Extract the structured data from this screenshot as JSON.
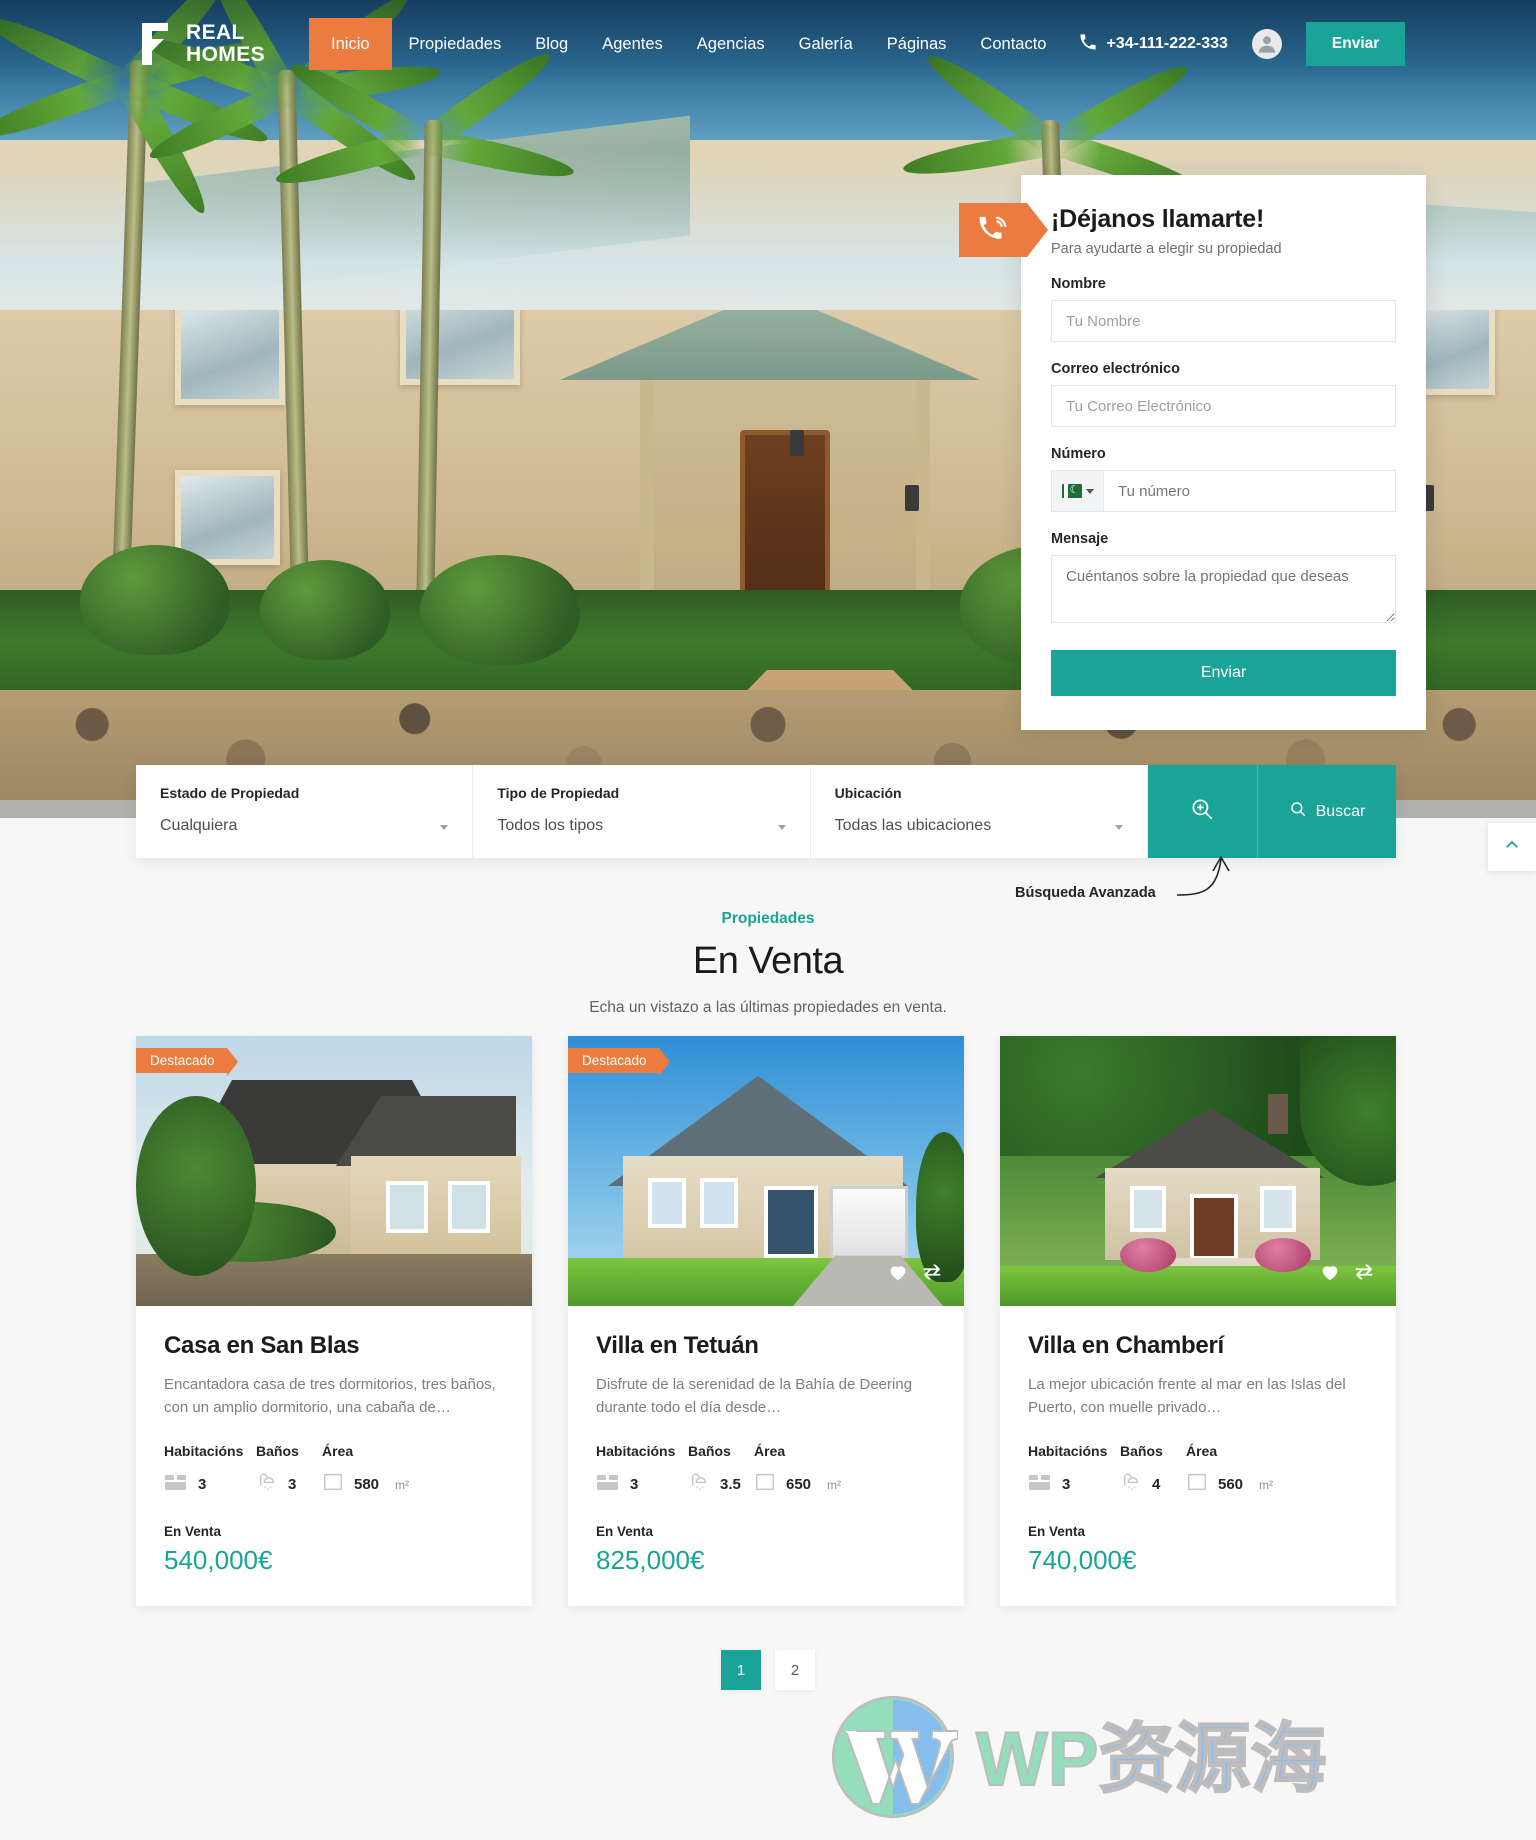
{
  "brand": {
    "line1": "REAL",
    "line2": "HOMES",
    "logo_icon": "real-homes-logo"
  },
  "nav": {
    "items": [
      {
        "label": "Inicio",
        "active": true
      },
      {
        "label": "Propiedades",
        "active": false
      },
      {
        "label": "Blog",
        "active": false
      },
      {
        "label": "Agentes",
        "active": false
      },
      {
        "label": "Agencias",
        "active": false
      },
      {
        "label": "Galería",
        "active": false
      },
      {
        "label": "Páginas",
        "active": false
      },
      {
        "label": "Contacto",
        "active": false
      }
    ],
    "phone": "+34-111-222-333",
    "phone_icon": "phone-icon",
    "user_icon": "user-account-icon",
    "cta_label": "Enviar",
    "accent_orange": "#eb7b3e",
    "accent_teal": "#19a497"
  },
  "callback": {
    "badge_icon": "phone-ring-icon",
    "title": "¡Déjanos llamarte!",
    "subtitle": "Para ayudarte a elegir su propiedad",
    "fields": [
      {
        "label": "Nombre",
        "placeholder": "Tu Nombre",
        "value": ""
      },
      {
        "label": "Correo electrónico",
        "placeholder": "Tu Correo Electrónico",
        "value": ""
      },
      {
        "label": "Número",
        "placeholder": "Tu número",
        "value": ""
      },
      {
        "label": "Mensaje",
        "placeholder": "Cuéntanos sobre la propiedad que deseas",
        "value": ""
      }
    ],
    "country_flag": "pakistan-flag",
    "submit_label": "Enviar"
  },
  "search": {
    "filters": [
      {
        "label": "Estado de Propiedad",
        "value": "Cualquiera"
      },
      {
        "label": "Tipo de Propiedad",
        "value": "Todos los tipos"
      },
      {
        "label": "Ubicación",
        "value": "Todas las ubicaciones"
      }
    ],
    "advanced_icon": "magnifier-plus-icon",
    "search_icon": "search-icon",
    "search_label": "Buscar",
    "advanced_note": "Búsqueda Avanzada"
  },
  "scroll_top_icon": "chevron-up-icon",
  "section": {
    "eyebrow": "Propiedades",
    "title": "En Venta",
    "subtitle": "Echa un vistazo a las últimas propiedades en venta."
  },
  "specs_headers": {
    "beds": "Habitacións",
    "baths": "Baños",
    "area": "Área"
  },
  "area_unit": "m²",
  "properties": [
    {
      "badge": "Destacado",
      "title": "Casa en San Blas",
      "description": "Encantadora casa de tres dormitorios, tres baños, con un amplio dormitorio, una cabaña de…",
      "beds": "3",
      "baths": "3",
      "area": "580",
      "status": "En Venta",
      "price": "540,000€",
      "show_actions": false
    },
    {
      "badge": "Destacado",
      "title": "Villa en Tetuán",
      "description": "Disfrute de la serenidad de la Bahía de Deering durante todo el día desde…",
      "beds": "3",
      "baths": "3.5",
      "area": "650",
      "status": "En Venta",
      "price": "825,000€",
      "show_actions": true
    },
    {
      "badge": "",
      "title": "Villa en Chamberí",
      "description": "La mejor ubicación frente al mar en las Islas del Puerto, con muelle privado…",
      "beds": "3",
      "baths": "4",
      "area": "560",
      "status": "En Venta",
      "price": "740,000€",
      "show_actions": true
    }
  ],
  "card_action_icons": {
    "favorite": "heart-icon",
    "compare": "compare-arrows-icon"
  },
  "pagination": {
    "pages": [
      "1",
      "2"
    ],
    "current": "1"
  },
  "watermark": {
    "wp": "WP",
    "cn": "资源海",
    "logo_icon": "wordpress-logo-icon"
  }
}
